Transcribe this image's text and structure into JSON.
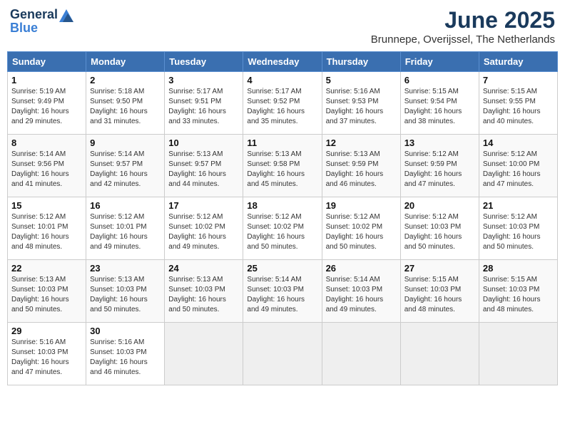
{
  "logo": {
    "general": "General",
    "blue": "Blue"
  },
  "title": "June 2025",
  "location": "Brunnepe, Overijssel, The Netherlands",
  "headers": [
    "Sunday",
    "Monday",
    "Tuesday",
    "Wednesday",
    "Thursday",
    "Friday",
    "Saturday"
  ],
  "weeks": [
    [
      {
        "day": "1",
        "info": "Sunrise: 5:19 AM\nSunset: 9:49 PM\nDaylight: 16 hours\nand 29 minutes."
      },
      {
        "day": "2",
        "info": "Sunrise: 5:18 AM\nSunset: 9:50 PM\nDaylight: 16 hours\nand 31 minutes."
      },
      {
        "day": "3",
        "info": "Sunrise: 5:17 AM\nSunset: 9:51 PM\nDaylight: 16 hours\nand 33 minutes."
      },
      {
        "day": "4",
        "info": "Sunrise: 5:17 AM\nSunset: 9:52 PM\nDaylight: 16 hours\nand 35 minutes."
      },
      {
        "day": "5",
        "info": "Sunrise: 5:16 AM\nSunset: 9:53 PM\nDaylight: 16 hours\nand 37 minutes."
      },
      {
        "day": "6",
        "info": "Sunrise: 5:15 AM\nSunset: 9:54 PM\nDaylight: 16 hours\nand 38 minutes."
      },
      {
        "day": "7",
        "info": "Sunrise: 5:15 AM\nSunset: 9:55 PM\nDaylight: 16 hours\nand 40 minutes."
      }
    ],
    [
      {
        "day": "8",
        "info": "Sunrise: 5:14 AM\nSunset: 9:56 PM\nDaylight: 16 hours\nand 41 minutes."
      },
      {
        "day": "9",
        "info": "Sunrise: 5:14 AM\nSunset: 9:57 PM\nDaylight: 16 hours\nand 42 minutes."
      },
      {
        "day": "10",
        "info": "Sunrise: 5:13 AM\nSunset: 9:57 PM\nDaylight: 16 hours\nand 44 minutes."
      },
      {
        "day": "11",
        "info": "Sunrise: 5:13 AM\nSunset: 9:58 PM\nDaylight: 16 hours\nand 45 minutes."
      },
      {
        "day": "12",
        "info": "Sunrise: 5:13 AM\nSunset: 9:59 PM\nDaylight: 16 hours\nand 46 minutes."
      },
      {
        "day": "13",
        "info": "Sunrise: 5:12 AM\nSunset: 9:59 PM\nDaylight: 16 hours\nand 47 minutes."
      },
      {
        "day": "14",
        "info": "Sunrise: 5:12 AM\nSunset: 10:00 PM\nDaylight: 16 hours\nand 47 minutes."
      }
    ],
    [
      {
        "day": "15",
        "info": "Sunrise: 5:12 AM\nSunset: 10:01 PM\nDaylight: 16 hours\nand 48 minutes."
      },
      {
        "day": "16",
        "info": "Sunrise: 5:12 AM\nSunset: 10:01 PM\nDaylight: 16 hours\nand 49 minutes."
      },
      {
        "day": "17",
        "info": "Sunrise: 5:12 AM\nSunset: 10:02 PM\nDaylight: 16 hours\nand 49 minutes."
      },
      {
        "day": "18",
        "info": "Sunrise: 5:12 AM\nSunset: 10:02 PM\nDaylight: 16 hours\nand 50 minutes."
      },
      {
        "day": "19",
        "info": "Sunrise: 5:12 AM\nSunset: 10:02 PM\nDaylight: 16 hours\nand 50 minutes."
      },
      {
        "day": "20",
        "info": "Sunrise: 5:12 AM\nSunset: 10:03 PM\nDaylight: 16 hours\nand 50 minutes."
      },
      {
        "day": "21",
        "info": "Sunrise: 5:12 AM\nSunset: 10:03 PM\nDaylight: 16 hours\nand 50 minutes."
      }
    ],
    [
      {
        "day": "22",
        "info": "Sunrise: 5:13 AM\nSunset: 10:03 PM\nDaylight: 16 hours\nand 50 minutes."
      },
      {
        "day": "23",
        "info": "Sunrise: 5:13 AM\nSunset: 10:03 PM\nDaylight: 16 hours\nand 50 minutes."
      },
      {
        "day": "24",
        "info": "Sunrise: 5:13 AM\nSunset: 10:03 PM\nDaylight: 16 hours\nand 50 minutes."
      },
      {
        "day": "25",
        "info": "Sunrise: 5:14 AM\nSunset: 10:03 PM\nDaylight: 16 hours\nand 49 minutes."
      },
      {
        "day": "26",
        "info": "Sunrise: 5:14 AM\nSunset: 10:03 PM\nDaylight: 16 hours\nand 49 minutes."
      },
      {
        "day": "27",
        "info": "Sunrise: 5:15 AM\nSunset: 10:03 PM\nDaylight: 16 hours\nand 48 minutes."
      },
      {
        "day": "28",
        "info": "Sunrise: 5:15 AM\nSunset: 10:03 PM\nDaylight: 16 hours\nand 48 minutes."
      }
    ],
    [
      {
        "day": "29",
        "info": "Sunrise: 5:16 AM\nSunset: 10:03 PM\nDaylight: 16 hours\nand 47 minutes."
      },
      {
        "day": "30",
        "info": "Sunrise: 5:16 AM\nSunset: 10:03 PM\nDaylight: 16 hours\nand 46 minutes."
      },
      {
        "day": "",
        "info": ""
      },
      {
        "day": "",
        "info": ""
      },
      {
        "day": "",
        "info": ""
      },
      {
        "day": "",
        "info": ""
      },
      {
        "day": "",
        "info": ""
      }
    ]
  ]
}
